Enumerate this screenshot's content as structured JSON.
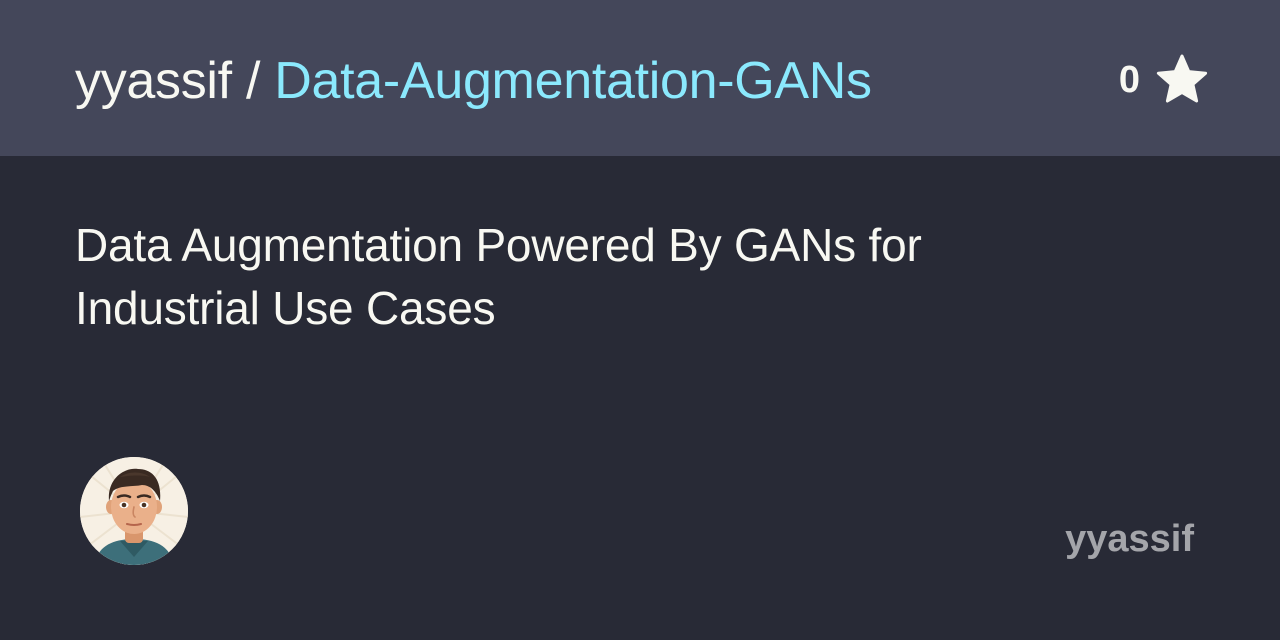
{
  "header": {
    "owner": "yyassif",
    "separator": " / ",
    "repo_name": "Data-Augmentation-GANs",
    "star_count": "0"
  },
  "description": {
    "line1": "Data Augmentation Powered By GANs for",
    "line2": "Industrial Use Cases"
  },
  "footer": {
    "username": "yyassif"
  },
  "icons": {
    "star": "star-icon",
    "avatar": "avatar-icon"
  },
  "colors": {
    "background": "#282a36",
    "header_background": "#44475a",
    "repo_name": "#8be9fd",
    "text": "#f8f8f2",
    "muted": "#a4a5aa"
  }
}
